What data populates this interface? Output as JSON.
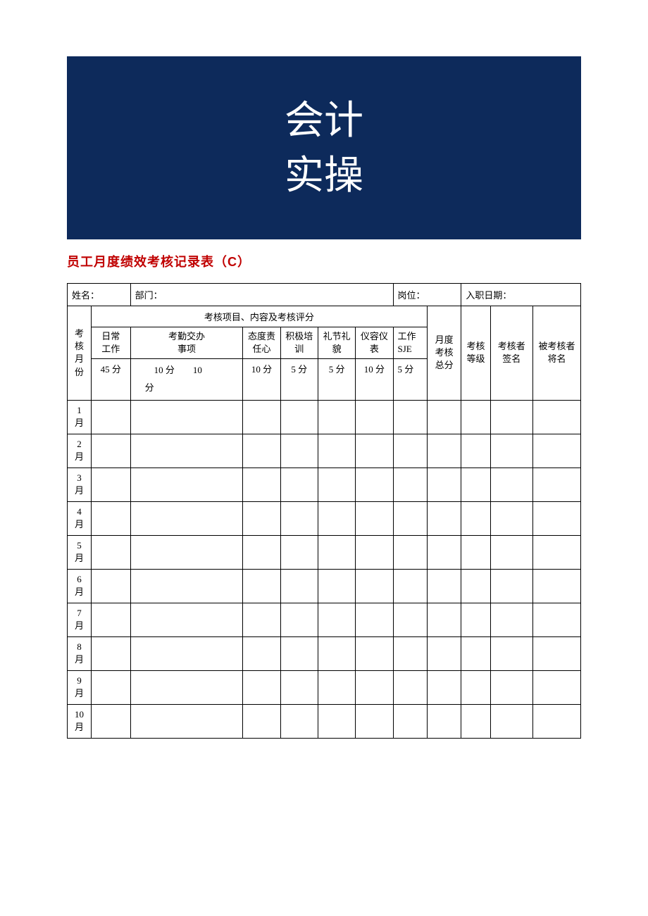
{
  "banner": {
    "line1": "会计",
    "line2": "实操"
  },
  "title": "员工月度绩效考核记录表（C）",
  "info": {
    "name_label": "姓名：",
    "dept_label": "部门：",
    "position_label": "岗位：",
    "hire_label": "入职日期："
  },
  "header": {
    "month_col": "考核月份",
    "assess_items": "考核项目、内容及考核评分",
    "daily": "日常工作",
    "attend": "考勤交办事项",
    "attitude": "态度责任心",
    "training": "积极培训",
    "etiquette": "礼节礼貌",
    "appearance": "仪容仪表",
    "sje": "工作SJE",
    "total": "月度考核总分",
    "grade": "考核等级",
    "signer": "考核者签名",
    "signee": "被考核者将名",
    "score_daily": "45 分",
    "score_attend": "10 分　　10 分",
    "score_attitude": "10 分",
    "score_training": "5 分",
    "score_etiquette": "5 分",
    "score_appearance": "10 分",
    "score_sje": "5 分"
  },
  "months": [
    "1 月",
    "2 月",
    "3 月",
    "4 月",
    "5 月",
    "6 月",
    "7 月",
    "8 月",
    "9 月",
    "10 月"
  ]
}
